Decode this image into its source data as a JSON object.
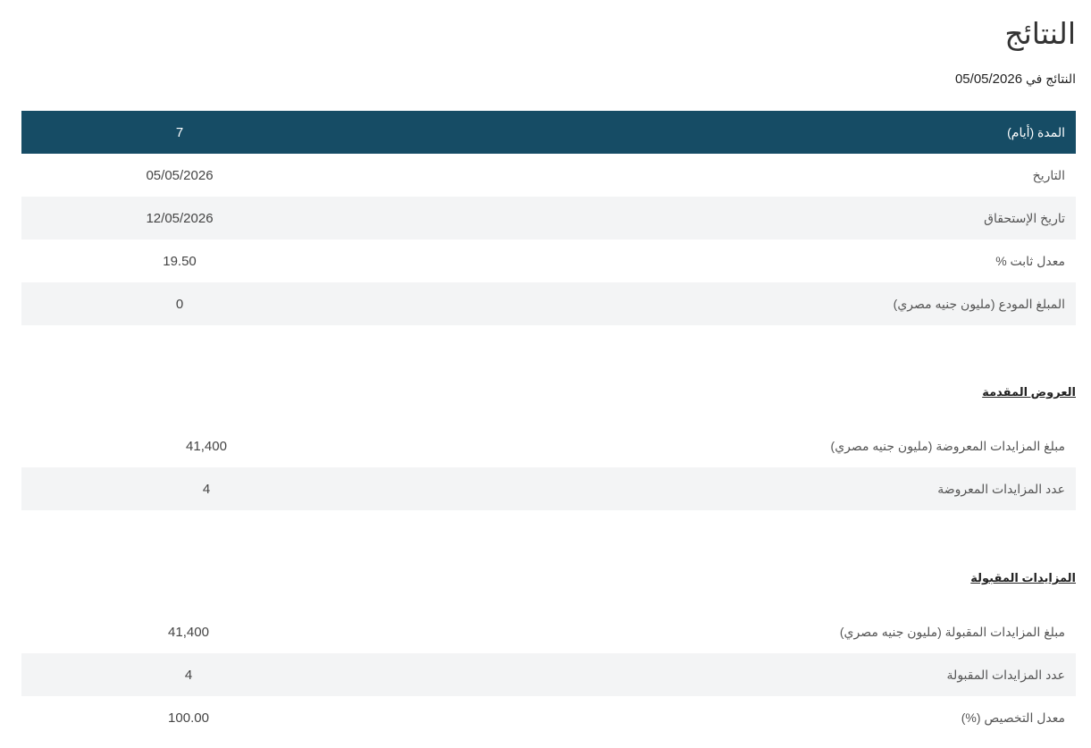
{
  "page": {
    "title": "النتائج",
    "results_label": "النتائج في",
    "results_date": "05/05/2026"
  },
  "main_table": {
    "header": {
      "label": "المدة (أيام)",
      "value": "7"
    },
    "rows": [
      {
        "label": "التاريخ",
        "value": "05/05/2026"
      },
      {
        "label": "تاريخ الإستحقاق",
        "value": "12/05/2026"
      },
      {
        "label": "معدل ثابت %",
        "value": "19.50"
      },
      {
        "label": "المبلغ المودع (مليون جنيه مصري)",
        "value": "0"
      }
    ]
  },
  "offered": {
    "heading": "العروض المقدمة",
    "rows": [
      {
        "label": "مبلغ المزايدات المعروضة (مليون جنيه مصري)",
        "value": "41,400"
      },
      {
        "label": "عدد المزايدات المعروضة",
        "value": "4"
      }
    ]
  },
  "accepted": {
    "heading": "المزايدات المقبولة",
    "rows": [
      {
        "label": "مبلغ المزايدات المقبولة (مليون جنيه مصري)",
        "value": "41,400"
      },
      {
        "label": "عدد المزايدات المقبولة",
        "value": "4"
      },
      {
        "label": "معدل التخصيص (%)",
        "value": "100.00"
      }
    ]
  },
  "colors": {
    "header_bg": "#164c65",
    "row_alt_bg": "#f3f4f5"
  }
}
